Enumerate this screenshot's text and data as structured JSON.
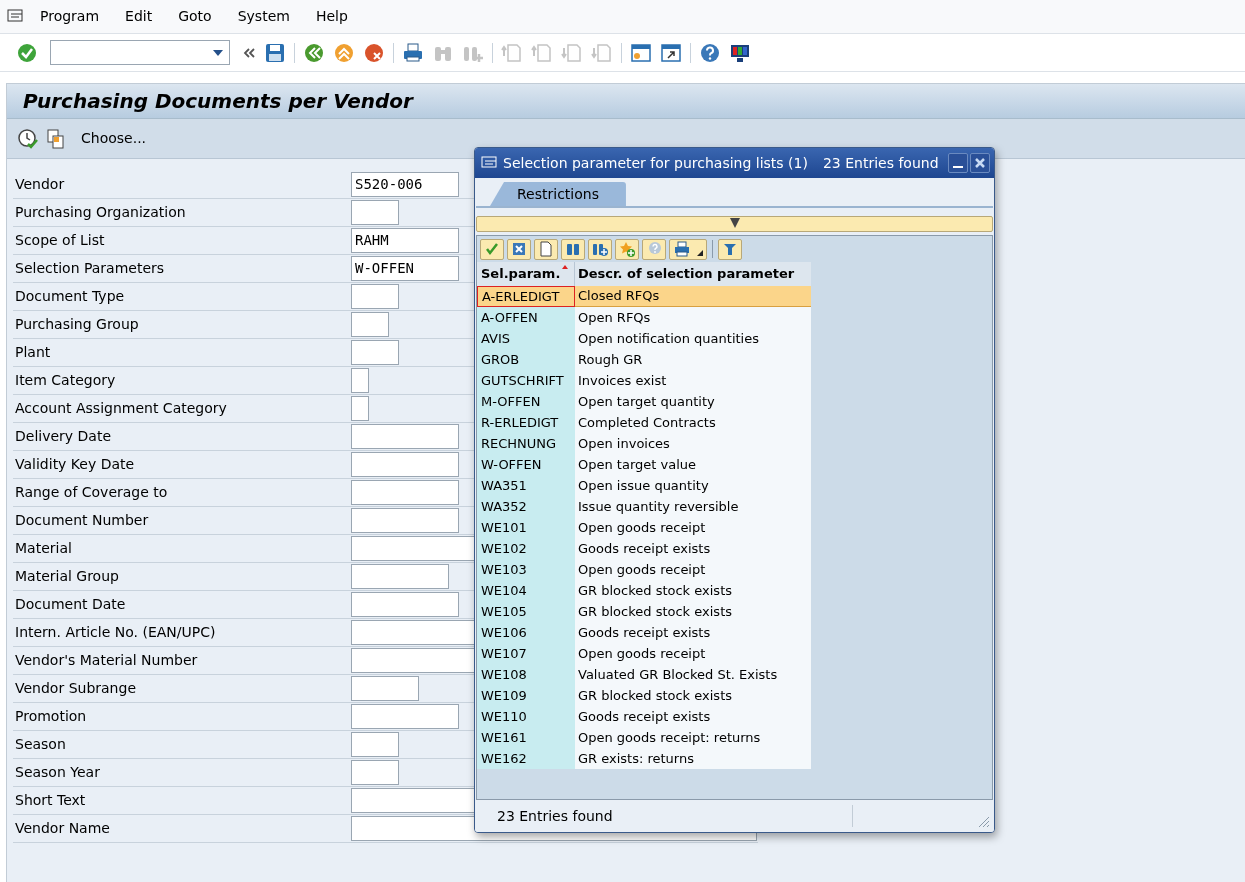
{
  "menu": [
    "Program",
    "Edit",
    "Goto",
    "System",
    "Help"
  ],
  "toolbar": [
    {
      "kind": "enter",
      "disabled": false
    },
    {
      "kind": "command"
    },
    {
      "kind": "collapse",
      "disabled": false
    },
    {
      "kind": "save",
      "disabled": false
    },
    {
      "kind": "sep"
    },
    {
      "kind": "back",
      "disabled": false
    },
    {
      "kind": "exit",
      "disabled": false
    },
    {
      "kind": "cancel",
      "disabled": false
    },
    {
      "kind": "sep"
    },
    {
      "kind": "print",
      "disabled": false
    },
    {
      "kind": "find",
      "disabled": true
    },
    {
      "kind": "findnext",
      "disabled": true
    },
    {
      "kind": "sep"
    },
    {
      "kind": "first",
      "disabled": true
    },
    {
      "kind": "prev",
      "disabled": true
    },
    {
      "kind": "next",
      "disabled": true
    },
    {
      "kind": "last",
      "disabled": true
    },
    {
      "kind": "sep"
    },
    {
      "kind": "session",
      "disabled": false
    },
    {
      "kind": "shortcut",
      "disabled": false
    },
    {
      "kind": "sep"
    },
    {
      "kind": "help",
      "disabled": false
    },
    {
      "kind": "layout",
      "disabled": false
    }
  ],
  "title": "Purchasing Documents per Vendor",
  "app_toolbar": {
    "choose": "Choose..."
  },
  "fields": [
    {
      "label": "Vendor",
      "value": "S520-006"
    },
    {
      "label": "Purchasing Organization"
    },
    {
      "label": "Scope of List",
      "value": "RAHM"
    },
    {
      "label": "Selection Parameters",
      "value": "W-OFFEN"
    },
    {
      "label": "Document Type"
    },
    {
      "label": "Purchasing Group"
    },
    {
      "label": "Plant"
    },
    {
      "label": "Item Category"
    },
    {
      "label": "Account Assignment Category"
    },
    {
      "label": "Delivery Date"
    },
    {
      "label": "Validity Key Date"
    },
    {
      "label": "Range of Coverage to"
    },
    {
      "label": "Document Number"
    },
    {
      "label": "Material"
    },
    {
      "label": "Material Group"
    },
    {
      "label": "Document Date"
    },
    {
      "label": "Intern. Article No. (EAN/UPC)"
    },
    {
      "label": "Vendor's Material Number"
    },
    {
      "label": "Vendor Subrange"
    },
    {
      "label": "Promotion"
    },
    {
      "label": "Season"
    },
    {
      "label": "Season Year"
    },
    {
      "label": "Short Text"
    },
    {
      "label": "Vendor Name"
    }
  ],
  "dialog": {
    "title": "Selection parameter for purchasing lists (1)",
    "count": "23 Entries found",
    "tab": "Restrictions",
    "tools": [
      {
        "kind": "check"
      },
      {
        "kind": "cancel"
      },
      {
        "kind": "new"
      },
      {
        "kind": "find"
      },
      {
        "kind": "findnext"
      },
      {
        "kind": "favorite"
      },
      {
        "kind": "help"
      },
      {
        "kind": "print"
      },
      {
        "kind": "filter"
      }
    ],
    "columns": [
      "Sel.param.",
      "Descr. of selection parameter"
    ],
    "rows": [
      {
        "code": "A-ERLEDIGT",
        "text": "Closed RFQs",
        "selected": true
      },
      {
        "code": "A-OFFEN",
        "text": "Open RFQs",
        "selected": false
      },
      {
        "code": "AVIS",
        "text": "Open notification quantities",
        "selected": false
      },
      {
        "code": "GROB",
        "text": "Rough GR",
        "selected": false
      },
      {
        "code": "GUTSCHRIFT",
        "text": "Invoices exist",
        "selected": false
      },
      {
        "code": "M-OFFEN",
        "text": "Open target quantity",
        "selected": false
      },
      {
        "code": "R-ERLEDIGT",
        "text": "Completed Contracts",
        "selected": false
      },
      {
        "code": "RECHNUNG",
        "text": "Open invoices",
        "selected": false
      },
      {
        "code": "W-OFFEN",
        "text": "Open target value",
        "selected": false
      },
      {
        "code": "WA351",
        "text": "Open issue quantity",
        "selected": false
      },
      {
        "code": "WA352",
        "text": "Issue quantity reversible",
        "selected": false
      },
      {
        "code": "WE101",
        "text": "Open goods receipt",
        "selected": false
      },
      {
        "code": "WE102",
        "text": "Goods receipt exists",
        "selected": false
      },
      {
        "code": "WE103",
        "text": "Open goods receipt",
        "selected": false
      },
      {
        "code": "WE104",
        "text": "GR blocked stock exists",
        "selected": false
      },
      {
        "code": "WE105",
        "text": "GR blocked stock exists",
        "selected": false
      },
      {
        "code": "WE106",
        "text": "Goods receipt exists",
        "selected": false
      },
      {
        "code": "WE107",
        "text": "Open goods receipt",
        "selected": false
      },
      {
        "code": "WE108",
        "text": "Valuated GR Blocked St. Exists",
        "selected": false
      },
      {
        "code": "WE109",
        "text": "GR blocked stock exists",
        "selected": false
      },
      {
        "code": "WE110",
        "text": "Goods receipt exists",
        "selected": false
      },
      {
        "code": "WE161",
        "text": "Open goods receipt: returns",
        "selected": false
      },
      {
        "code": "WE162",
        "text": "GR exists: returns",
        "selected": false
      }
    ],
    "status": "23 Entries found"
  }
}
